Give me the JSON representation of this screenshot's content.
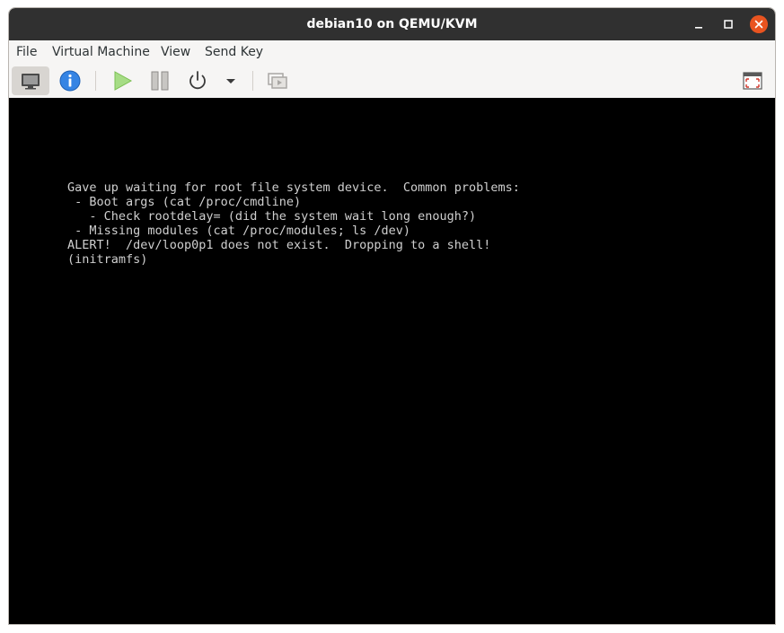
{
  "window": {
    "title": "debian10 on QEMU/KVM"
  },
  "titlebar": {
    "buttons": {
      "minimize_icon": "minimize-icon",
      "maximize_icon": "maximize-icon",
      "close_icon": "close-icon"
    }
  },
  "menubar": {
    "items": [
      {
        "label": "File"
      },
      {
        "label": "Virtual Machine"
      },
      {
        "label": "View"
      },
      {
        "label": "Send Key"
      }
    ]
  },
  "toolbar": {
    "buttons": [
      {
        "icon": "monitor-icon",
        "active": true
      },
      {
        "icon": "info-icon"
      },
      {
        "icon": "play-icon"
      },
      {
        "icon": "pause-icon"
      },
      {
        "icon": "power-icon"
      },
      {
        "icon": "chevron-down-icon"
      },
      {
        "icon": "snapshots-icon"
      },
      {
        "icon": "fullscreen-icon"
      }
    ]
  },
  "console": {
    "lines": [
      "Gave up waiting for root file system device.  Common problems:",
      " - Boot args (cat /proc/cmdline)",
      "   - Check rootdelay= (did the system wait long enough?)",
      " - Missing modules (cat /proc/modules; ls /dev)",
      "ALERT!  /dev/loop0p1 does not exist.  Dropping to a shell!",
      "(initramfs)"
    ]
  },
  "colors": {
    "titlebar_bg": "#303030",
    "close_button": "#e95420",
    "screen_bg": "#000000",
    "console_text": "#cfcfcf",
    "info_blue": "#3584e4",
    "play_green": "#8ad25c"
  }
}
